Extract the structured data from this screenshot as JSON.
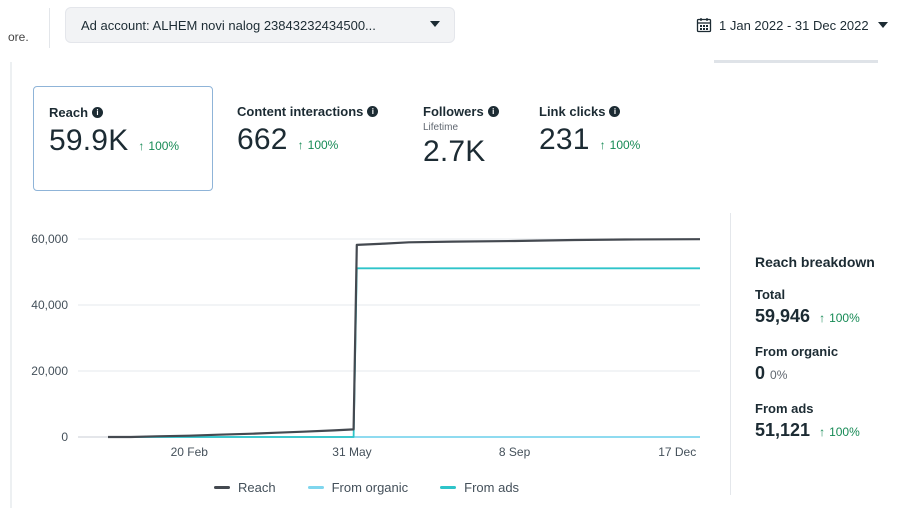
{
  "header": {
    "fragment_text": "ore.",
    "ad_account_label": "Ad account: ALHEM novi nalog 23843232434500...",
    "date_range": "1 Jan 2022 - 31 Dec 2022"
  },
  "metrics": [
    {
      "title": "Reach",
      "subtitle": "",
      "value": "59.9K",
      "change": "100%",
      "selected": true
    },
    {
      "title": "Content interactions",
      "subtitle": "",
      "value": "662",
      "change": "100%",
      "selected": false
    },
    {
      "title": "Followers",
      "subtitle": "Lifetime",
      "value": "2.7K",
      "change": "",
      "selected": false
    },
    {
      "title": "Link clicks",
      "subtitle": "",
      "value": "231",
      "change": "100%",
      "selected": false
    }
  ],
  "chart_data": {
    "type": "line",
    "x_ticks": [
      "20 Feb",
      "31 May",
      "8 Sep",
      "17 Dec"
    ],
    "y_ticks": [
      "0",
      "20,000",
      "40,000",
      "60,000"
    ],
    "ylim": [
      0,
      60000
    ],
    "xlim": [
      "2022-01-01",
      "2022-12-31"
    ],
    "grid": true,
    "legend_position": "bottom",
    "series": [
      {
        "name": "Reach",
        "color": "#444950",
        "points": [
          [
            "2022-01-01",
            0
          ],
          [
            "2022-01-15",
            0
          ],
          [
            "2022-01-31",
            200
          ],
          [
            "2022-02-20",
            400
          ],
          [
            "2022-03-10",
            700
          ],
          [
            "2022-03-31",
            1000
          ],
          [
            "2022-04-15",
            1300
          ],
          [
            "2022-05-01",
            1600
          ],
          [
            "2022-05-20",
            2000
          ],
          [
            "2022-06-01",
            2300
          ],
          [
            "2022-06-03",
            58200
          ],
          [
            "2022-06-20",
            58600
          ],
          [
            "2022-07-05",
            59000
          ],
          [
            "2022-08-01",
            59200
          ],
          [
            "2022-09-08",
            59400
          ],
          [
            "2022-10-15",
            59700
          ],
          [
            "2022-11-15",
            59850
          ],
          [
            "2022-12-31",
            59946
          ]
        ]
      },
      {
        "name": "From organic",
        "color": "#7fd6ee",
        "points": [
          [
            "2022-01-01",
            0
          ],
          [
            "2022-12-31",
            0
          ]
        ]
      },
      {
        "name": "From ads",
        "color": "#2ec4c9",
        "points": [
          [
            "2022-01-01",
            0
          ],
          [
            "2022-06-01",
            0
          ],
          [
            "2022-06-03",
            51121
          ],
          [
            "2022-12-31",
            51121
          ]
        ]
      }
    ]
  },
  "breakdown": {
    "title": "Reach breakdown",
    "items": [
      {
        "label": "Total",
        "value": "59,946",
        "change": "100%",
        "up": true
      },
      {
        "label": "From organic",
        "value": "0",
        "change": "0%",
        "up": false
      },
      {
        "label": "From ads",
        "value": "51,121",
        "change": "100%",
        "up": true
      }
    ]
  },
  "icons": {
    "calendar": "calendar-icon",
    "info": "info-icon",
    "dropdown": "caret-down-icon",
    "increase": "arrow-up-icon"
  },
  "colors": {
    "positive": "#168a55",
    "selected_border": "#8fb4d8",
    "text": "#1c2b33"
  }
}
